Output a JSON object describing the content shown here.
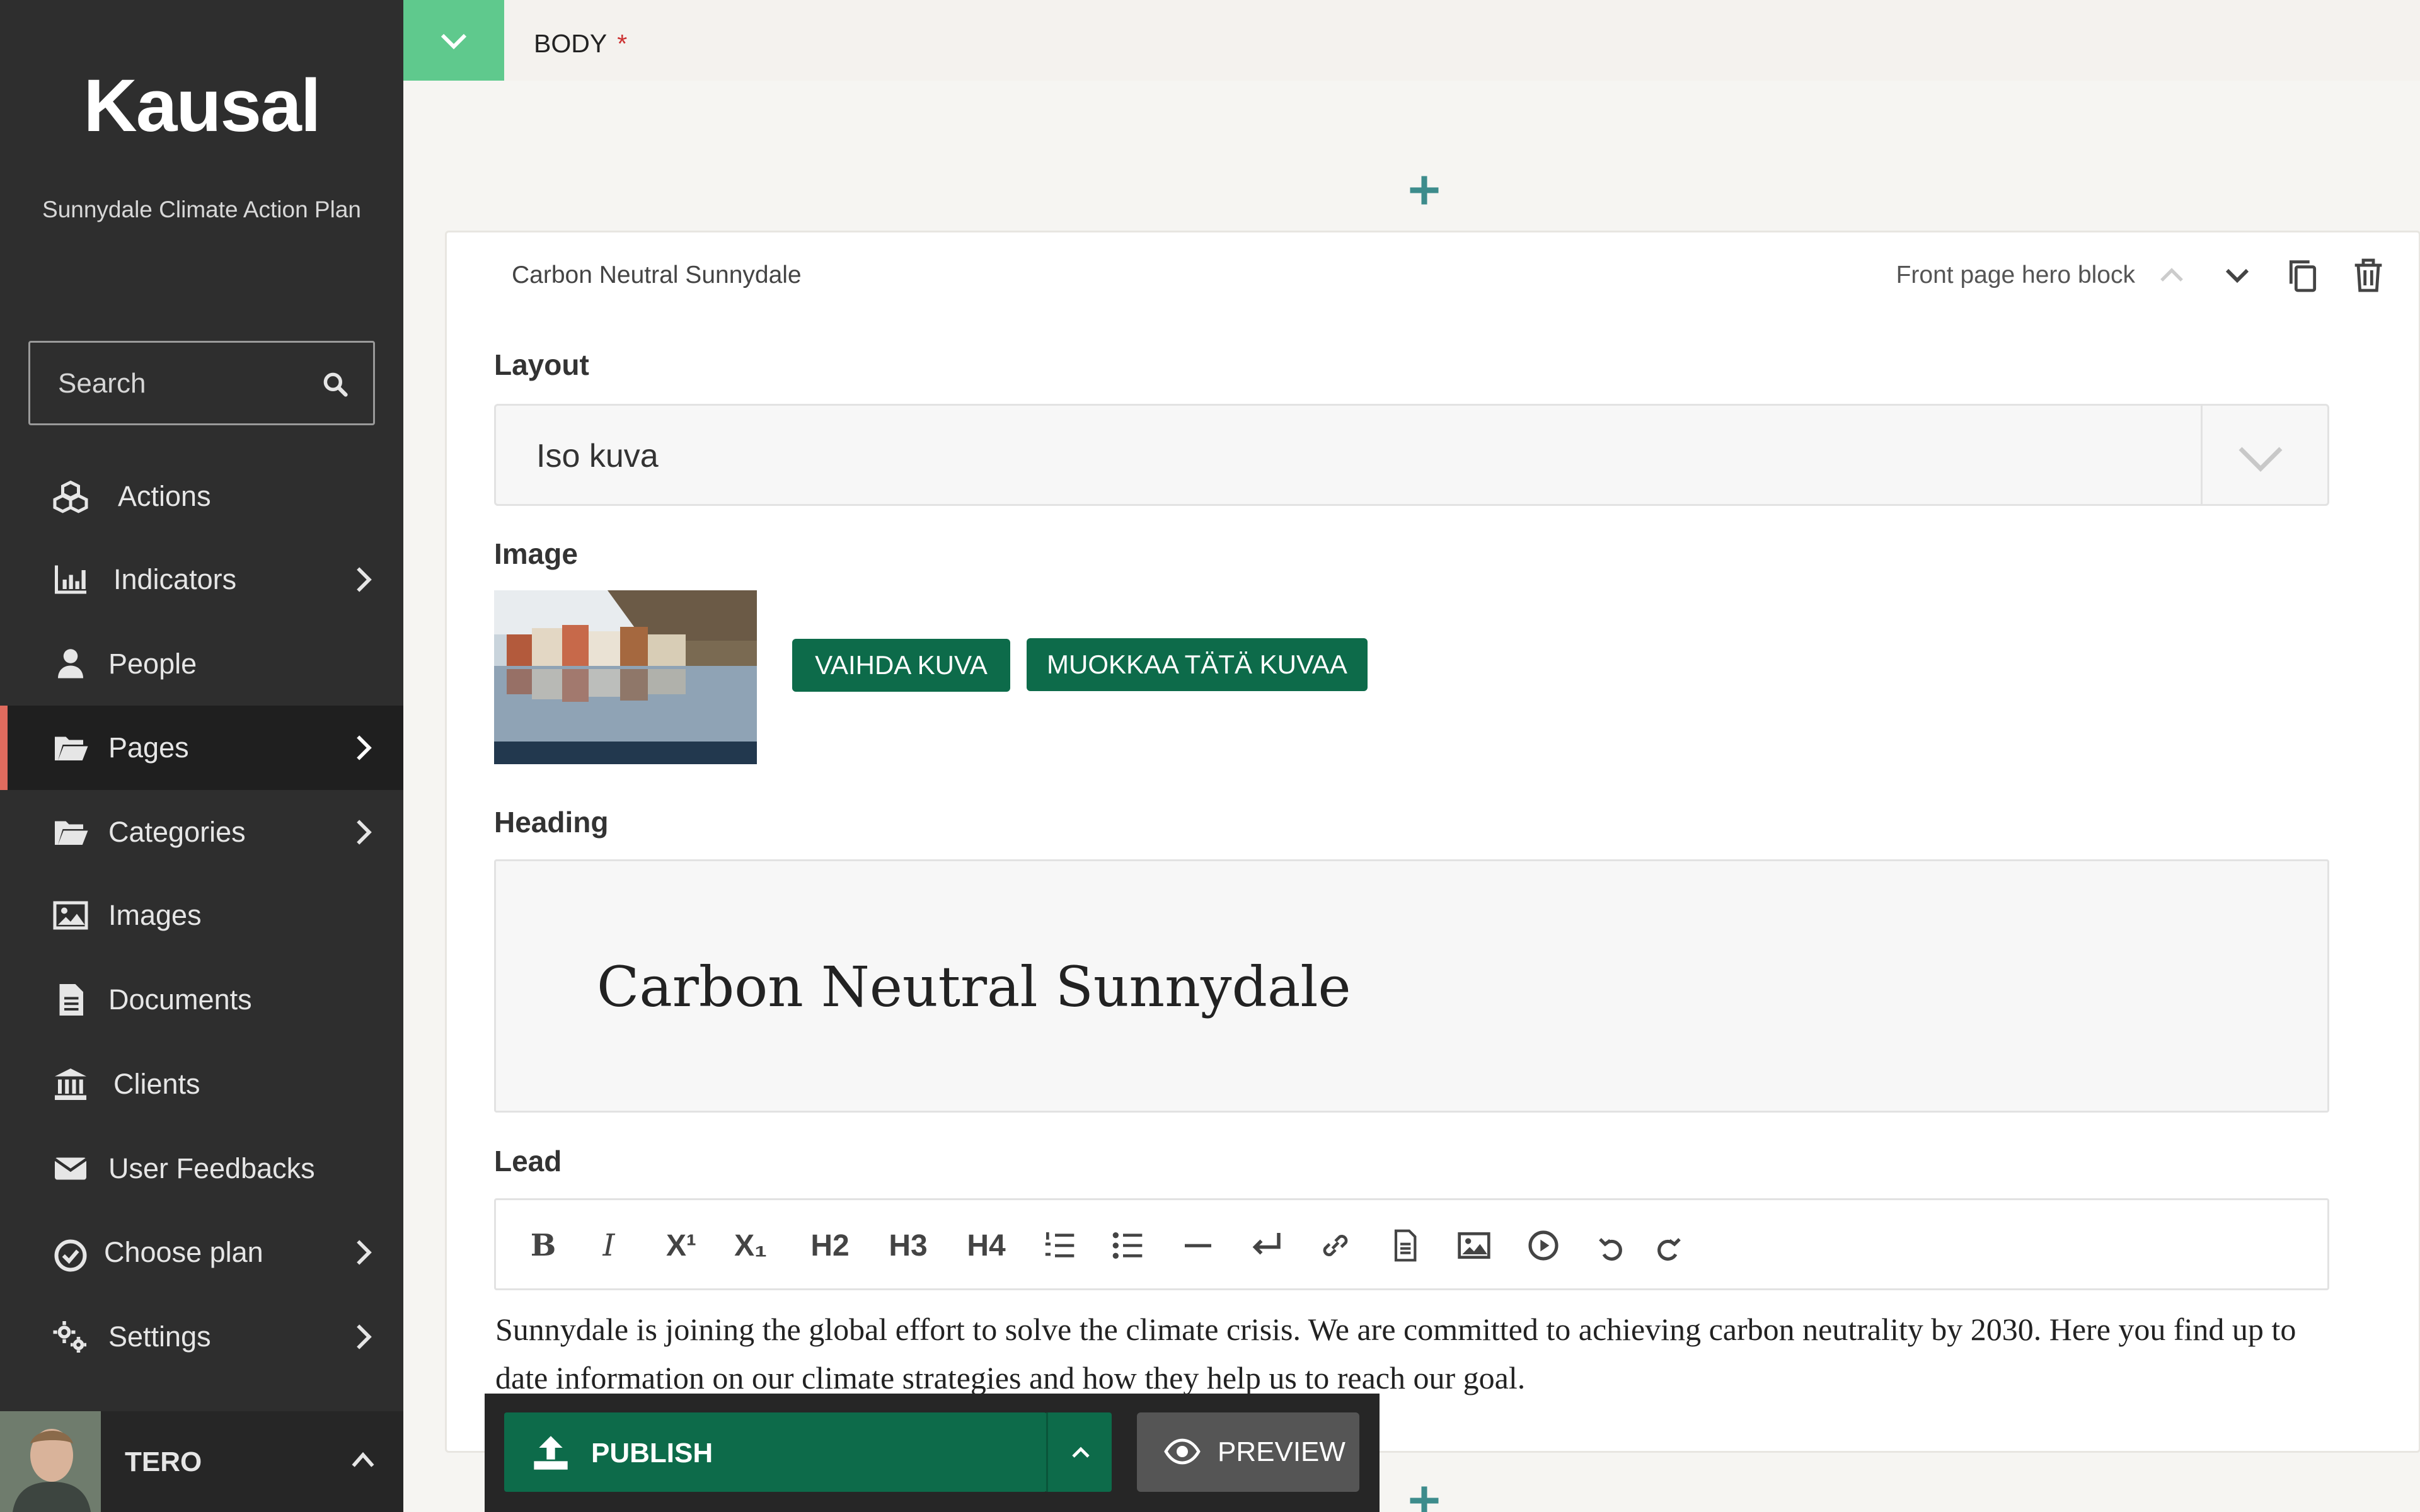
{
  "sidebar": {
    "logo": "Kausal",
    "subtitle": "Sunnydale Climate Action Plan",
    "search_placeholder": "Search",
    "items": [
      {
        "label": "Actions",
        "icon": "cubes-icon",
        "has_submenu": false
      },
      {
        "label": "Indicators",
        "icon": "bar-chart-icon",
        "has_submenu": true
      },
      {
        "label": "People",
        "icon": "user-icon",
        "has_submenu": false
      },
      {
        "label": "Pages",
        "icon": "folder-open-icon",
        "has_submenu": true,
        "active": true
      },
      {
        "label": "Categories",
        "icon": "folder-open-icon",
        "has_submenu": true
      },
      {
        "label": "Images",
        "icon": "image-icon",
        "has_submenu": false
      },
      {
        "label": "Documents",
        "icon": "document-icon",
        "has_submenu": false
      },
      {
        "label": "Clients",
        "icon": "bank-icon",
        "has_submenu": false
      },
      {
        "label": "User Feedbacks",
        "icon": "envelope-icon",
        "has_submenu": false
      },
      {
        "label": "Choose plan",
        "icon": "check-circle-icon",
        "has_submenu": true
      },
      {
        "label": "Settings",
        "icon": "cogs-icon",
        "has_submenu": true
      }
    ],
    "user": {
      "name": "TERO"
    }
  },
  "main": {
    "section_label": "BODY",
    "required_mark": "*",
    "block": {
      "title": "Carbon Neutral Sunnydale",
      "type": "Front page hero block",
      "layout_label": "Layout",
      "layout_value": "Iso kuva",
      "image_label": "Image",
      "change_image_button": "VAIHDA KUVA",
      "edit_image_button": "MUOKKAA TÄTÄ KUVAA",
      "heading_label": "Heading",
      "heading_value": "Carbon Neutral Sunnydale",
      "lead_label": "Lead",
      "toolbar": [
        "B",
        "I",
        "X¹",
        "X₁",
        "H2",
        "H3",
        "H4",
        "ordered-list",
        "bulleted-list",
        "horizontal-line",
        "line-break",
        "link",
        "document",
        "image",
        "embed",
        "undo",
        "redo"
      ],
      "lead_text": "Sunnydale is joining the global effort to solve the climate crisis. We are committed to achieving carbon neutrality by 2030. Here you find up to date information on our climate strategies and how they help us to reach our goal."
    }
  },
  "footer": {
    "publish_label": "PUBLISH",
    "preview_label": "PREVIEW"
  },
  "colors": {
    "sidebar_bg": "#2e2e2e",
    "accent_active": "#e06b5e",
    "primary_green": "#0d6b4a",
    "collapse_green": "#5fc98d",
    "plus_teal": "#3d8c8c"
  }
}
